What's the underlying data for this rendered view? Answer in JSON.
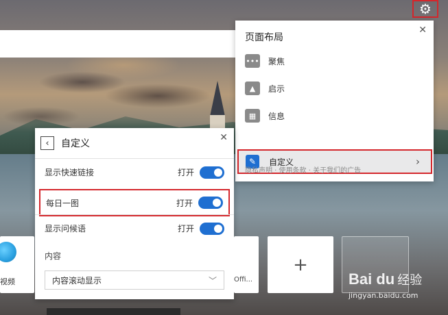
{
  "layout_panel": {
    "title": "页面布局",
    "options": [
      {
        "label": "聚焦",
        "icon": "focus-icon"
      },
      {
        "label": "启示",
        "icon": "inspiration-icon"
      },
      {
        "label": "信息",
        "icon": "info-icon"
      }
    ],
    "custom_label": "自定义",
    "footer": "隐私声明 · 使用条款 · 关于我们的广告"
  },
  "custom_panel": {
    "title": "自定义",
    "rows": [
      {
        "label": "显示快速链接",
        "state": "打开"
      },
      {
        "label": "每日一图",
        "state": "打开"
      },
      {
        "label": "显示问候语",
        "state": "打开"
      }
    ],
    "content_label": "内容",
    "content_select": "内容滚动显示"
  },
  "tiles": {
    "video_label": "视频",
    "office_label": "Offi...",
    "add_symbol": "+"
  },
  "watermark": {
    "brand": "Bai du",
    "brand_cn": "经验",
    "url": "jingyan.baidu.com"
  },
  "colors": {
    "accent": "#1f6fd1",
    "highlight": "#d4262b"
  }
}
